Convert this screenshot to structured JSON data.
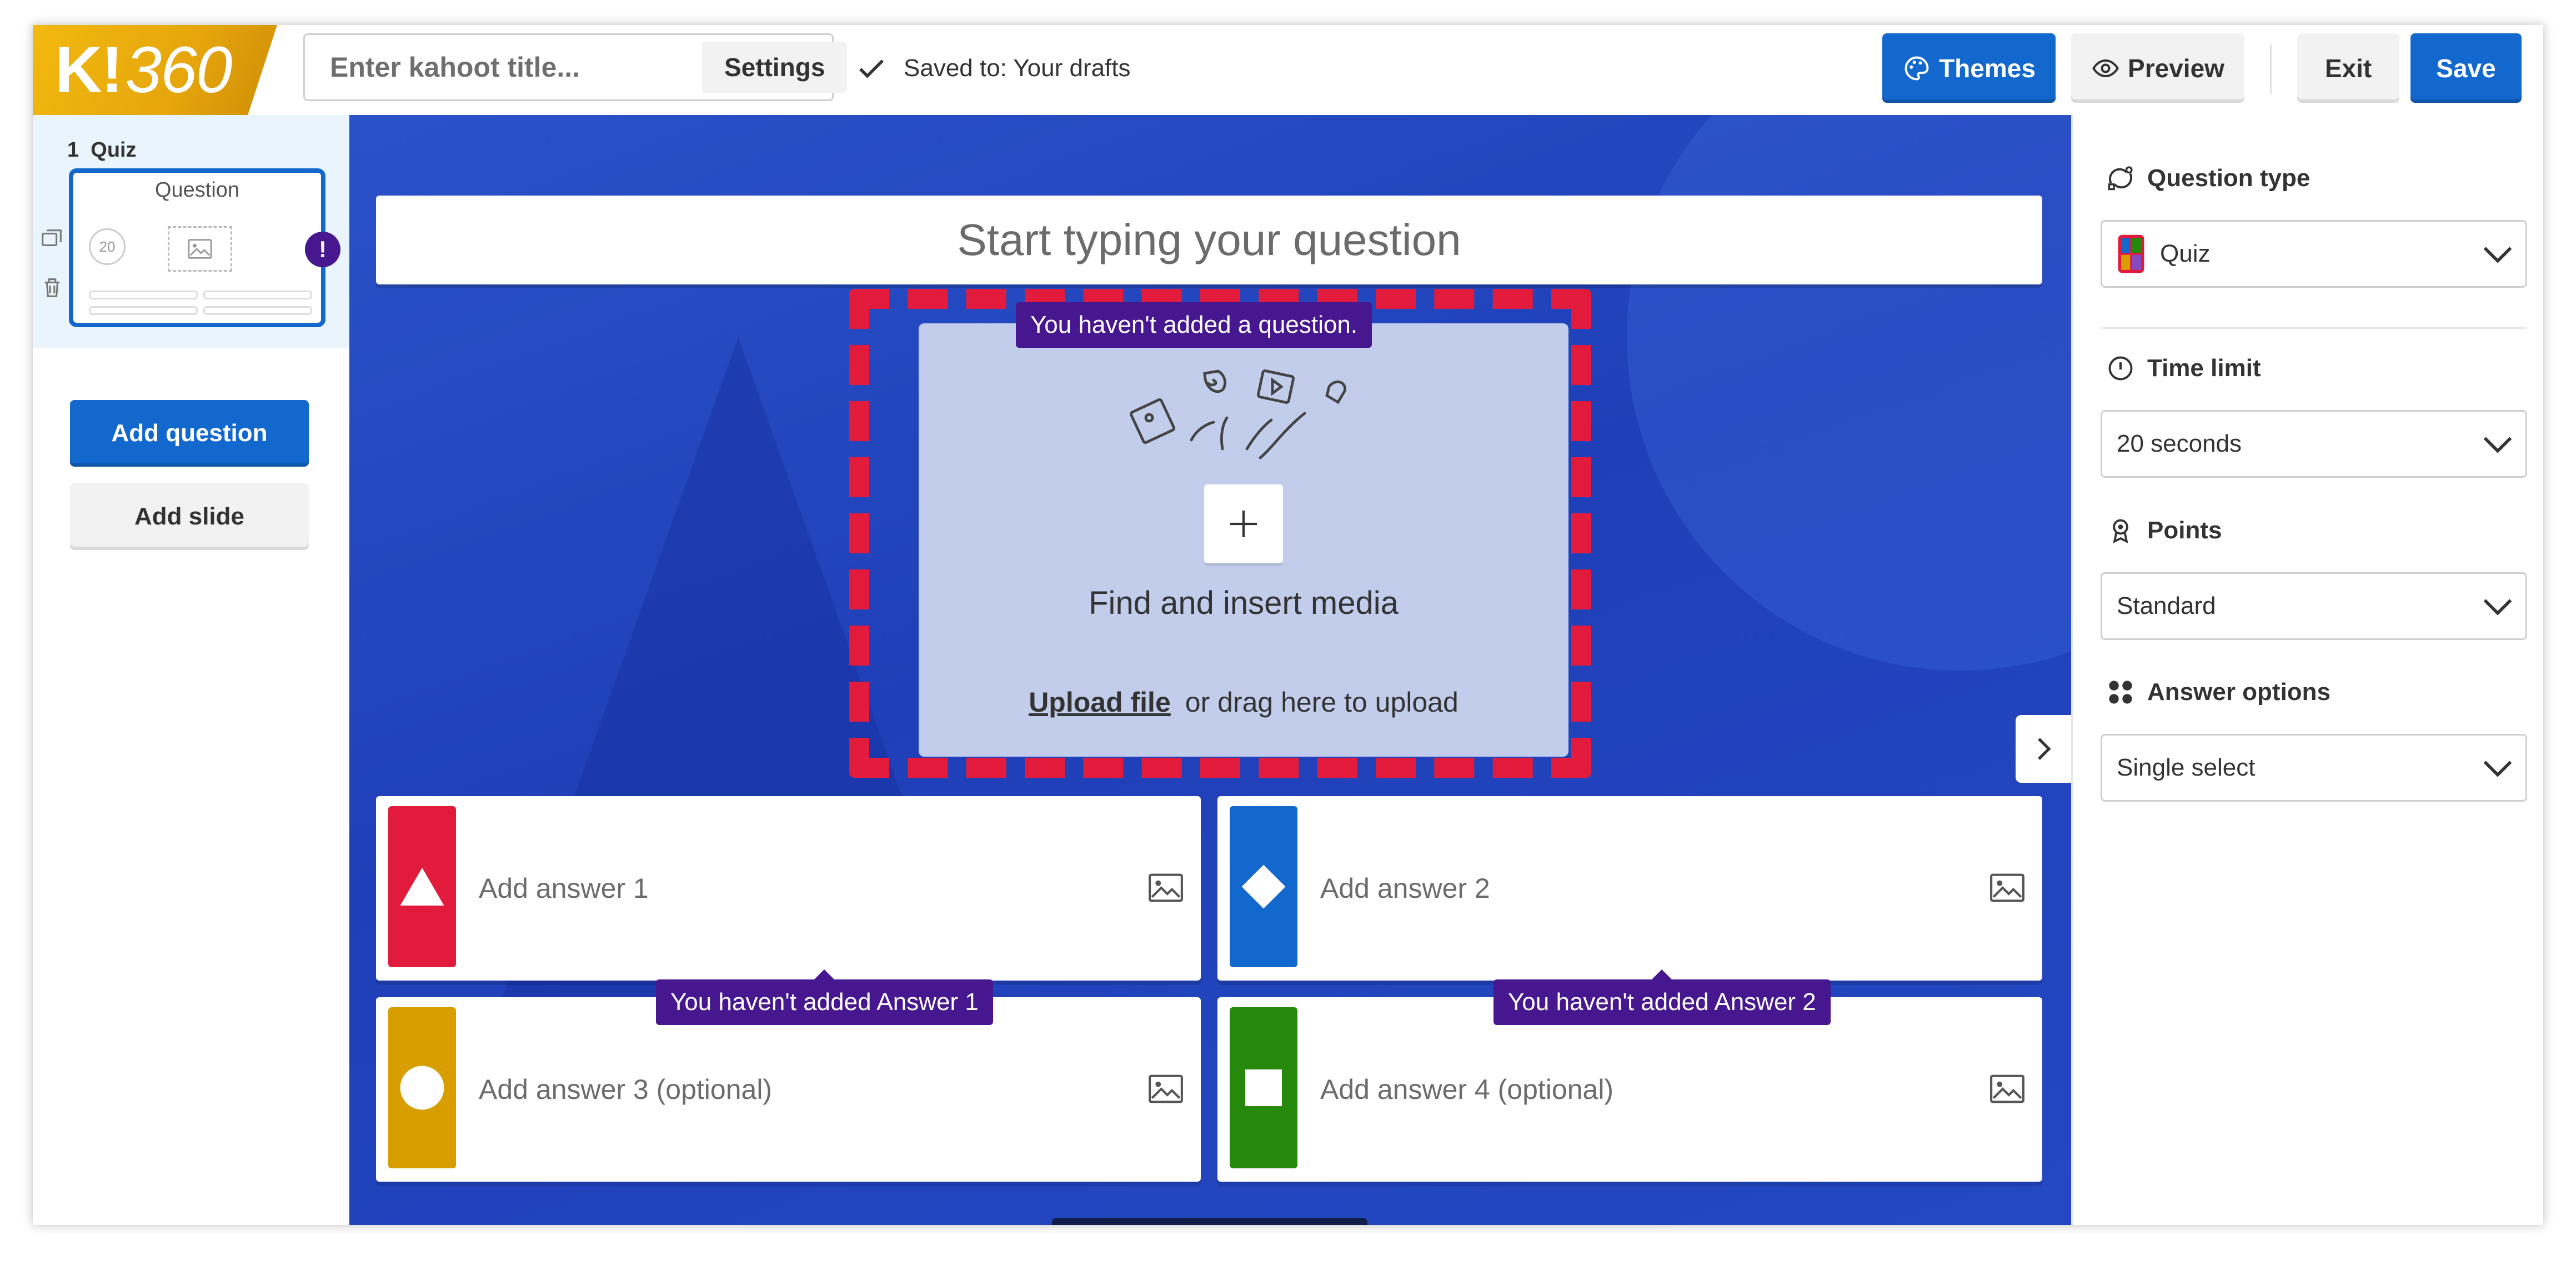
{
  "app": {
    "logo_main": "K!",
    "logo_suffix": "360",
    "title_placeholder": "Enter kahoot title...",
    "settings_label": "Settings",
    "saved_text": "Saved to: Your drafts",
    "themes_label": "Themes",
    "preview_label": "Preview",
    "exit_label": "Exit",
    "save_label": "Save",
    "accent_blue": "#1368ce",
    "warning_purple": "#46178f"
  },
  "sidebar": {
    "slide_number": "1",
    "slide_type": "Quiz",
    "thumb_title": "Question",
    "thumb_timer": "20",
    "thumb_warning": "!",
    "add_question_label": "Add question",
    "add_slide_label": "Add slide"
  },
  "editor": {
    "question_placeholder": "Start typing your question",
    "question_tip": "You haven't added a question.",
    "media_title": "Find and insert media",
    "upload_link": "Upload file",
    "upload_rest": "or drag here to upload",
    "answers": [
      {
        "placeholder": "Add answer 1",
        "color": "#e21b3c",
        "shape": "triangle-icon"
      },
      {
        "placeholder": "Add answer 2",
        "color": "#1368ce",
        "shape": "diamond-icon"
      },
      {
        "placeholder": "Add answer 3 (optional)",
        "color": "#d89e00",
        "shape": "circle-icon"
      },
      {
        "placeholder": "Add answer 4 (optional)",
        "color": "#26890c",
        "shape": "square-icon"
      }
    ],
    "answer1_tip": "You haven't added Answer 1",
    "answer2_tip": "You haven't added Answer 2"
  },
  "settings_panel": {
    "question_type_label": "Question type",
    "question_type_value": "Quiz",
    "time_limit_label": "Time limit",
    "time_limit_value": "20 seconds",
    "points_label": "Points",
    "points_value": "Standard",
    "answer_options_label": "Answer options",
    "answer_options_value": "Single select"
  }
}
